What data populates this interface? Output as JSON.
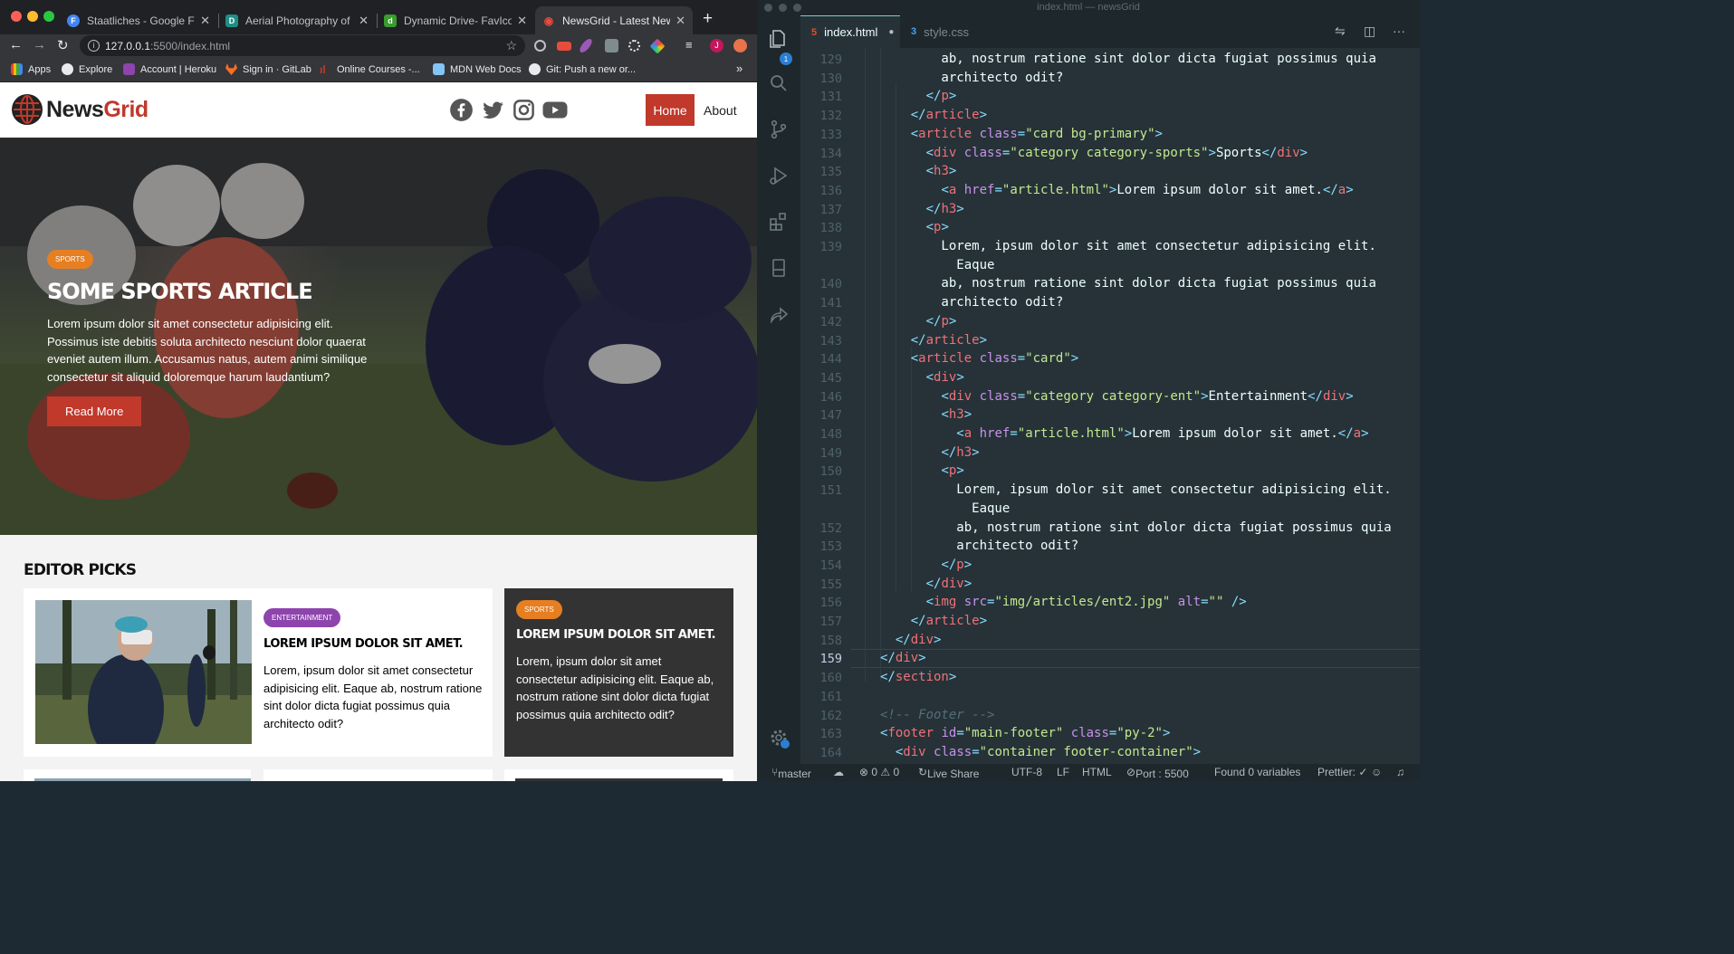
{
  "browser": {
    "tabs": [
      {
        "title": "Staatliches - Google Fonts",
        "favicon_color": "#4285f4",
        "favicon_letter": "F"
      },
      {
        "title": "Aerial Photography of Sea",
        "favicon_color": "#1d8f85",
        "favicon_letter": "D"
      },
      {
        "title": "Dynamic Drive- FavIcon Ge",
        "favicon_color": "#3a9b2e",
        "favicon_letter": "d"
      },
      {
        "title": "NewsGrid - Latest News",
        "favicon_color": "#c0392b",
        "favicon_letter": "◉"
      }
    ],
    "url_host": "127.0.0.1",
    "url_rest": ":5500/index.html",
    "bookmarks": [
      {
        "label": "Apps",
        "color": "#ea4335"
      },
      {
        "label": "Explore",
        "color": "#e8eaed"
      },
      {
        "label": "Account | Heroku",
        "color": "#8e44ad"
      },
      {
        "label": "Sign in · GitLab",
        "color": "#fc6d26"
      },
      {
        "label": "Online Courses -...",
        "color": "#c0392b"
      },
      {
        "label": "MDN Web Docs",
        "color": "#83c5f5"
      },
      {
        "label": "Git: Push a new or...",
        "color": "#e8eaed"
      }
    ],
    "bookmarks_more": "»"
  },
  "site": {
    "logo_part1": "News",
    "logo_part2": "Grid",
    "nav": {
      "home": "Home",
      "about": "About"
    },
    "hero": {
      "category": "Sports",
      "title": "Some Sports Article",
      "text": "Lorem ipsum dolor sit amet consectetur adipisicing elit. Possimus iste debitis soluta architecto nesciunt dolor quaerat eveniet autem illum. Accusamus natus, autem animi similique consectetur sit aliquid doloremque harum laudantium?",
      "button": "Read More"
    },
    "editor_picks_title": "Editor Picks",
    "cards": [
      {
        "category": "Entertainment",
        "title": "Lorem ipsum dolor sit amet.",
        "text": "Lorem, ipsum dolor sit amet consectetur adipisicing elit. Eaque ab, nostrum ratione sint dolor dicta fugiat possimus quia architecto odit?"
      },
      {
        "category": "Sports",
        "title": "Lorem ipsum dolor sit amet.",
        "text": "Lorem, ipsum dolor sit amet consectetur adipisicing elit. Eaque ab, nostrum ratione sint dolor dicta fugiat possimus quia architecto odit?"
      }
    ]
  },
  "editor": {
    "window_title": "index.html — newsGrid",
    "tabs": [
      {
        "label": "index.html",
        "icon": "5",
        "modified": "●"
      },
      {
        "label": "style.css",
        "icon": "3"
      }
    ],
    "explorer_badge": "1",
    "lines": [
      {
        "n": "129",
        "h": "<span class=\"cl-indent\" style=\"margin-left:0\"></span>        ab, nostrum ratione sint dolor dicta fugiat possimus quia"
      },
      {
        "n": "130",
        "h": "        architecto odit?"
      },
      {
        "n": "131",
        "h": "      <span class=\"p\">&lt;/</span><span class=\"t\">p</span><span class=\"p\">&gt;</span>"
      },
      {
        "n": "132",
        "h": "    <span class=\"p\">&lt;/</span><span class=\"t\">article</span><span class=\"p\">&gt;</span>"
      },
      {
        "n": "133",
        "h": "    <span class=\"p\">&lt;</span><span class=\"t\">article</span> <span class=\"a\">class</span><span class=\"p\">=</span><span class=\"s\">\"card bg-primary\"</span><span class=\"p\">&gt;</span>"
      },
      {
        "n": "134",
        "h": "      <span class=\"p\">&lt;</span><span class=\"t\">div</span> <span class=\"a\">class</span><span class=\"p\">=</span><span class=\"s\">\"category category-sports\"</span><span class=\"p\">&gt;</span>Sports<span class=\"p\">&lt;/</span><span class=\"t\">div</span><span class=\"p\">&gt;</span>"
      },
      {
        "n": "135",
        "h": "      <span class=\"p\">&lt;</span><span class=\"t\">h3</span><span class=\"p\">&gt;</span>"
      },
      {
        "n": "136",
        "h": "        <span class=\"p\">&lt;</span><span class=\"t\">a</span> <span class=\"a\">href</span><span class=\"p\">=</span><span class=\"s\">\"article.html\"</span><span class=\"p\">&gt;</span>Lorem ipsum dolor sit amet.<span class=\"p\">&lt;/</span><span class=\"t\">a</span><span class=\"p\">&gt;</span>"
      },
      {
        "n": "137",
        "h": "      <span class=\"p\">&lt;/</span><span class=\"t\">h3</span><span class=\"p\">&gt;</span>"
      },
      {
        "n": "138",
        "h": "      <span class=\"p\">&lt;</span><span class=\"t\">p</span><span class=\"p\">&gt;</span>"
      },
      {
        "n": "139",
        "h": "        Lorem, ipsum dolor sit amet consectetur adipisicing elit.\n          Eaque"
      },
      {
        "n": "140",
        "h": "        ab, nostrum ratione sint dolor dicta fugiat possimus quia"
      },
      {
        "n": "141",
        "h": "        architecto odit?"
      },
      {
        "n": "142",
        "h": "      <span class=\"p\">&lt;/</span><span class=\"t\">p</span><span class=\"p\">&gt;</span>"
      },
      {
        "n": "143",
        "h": "    <span class=\"p\">&lt;/</span><span class=\"t\">article</span><span class=\"p\">&gt;</span>"
      },
      {
        "n": "144",
        "h": "    <span class=\"p\">&lt;</span><span class=\"t\">article</span> <span class=\"a\">class</span><span class=\"p\">=</span><span class=\"s\">\"card\"</span><span class=\"p\">&gt;</span>"
      },
      {
        "n": "145",
        "h": "      <span class=\"p\">&lt;</span><span class=\"t\">div</span><span class=\"p\">&gt;</span>"
      },
      {
        "n": "146",
        "h": "        <span class=\"p\">&lt;</span><span class=\"t\">div</span> <span class=\"a\">class</span><span class=\"p\">=</span><span class=\"s\">\"category category-ent\"</span><span class=\"p\">&gt;</span>Entertainment<span class=\"p\">&lt;/</span><span class=\"t\">div</span><span class=\"p\">&gt;</span>"
      },
      {
        "n": "147",
        "h": "        <span class=\"p\">&lt;</span><span class=\"t\">h3</span><span class=\"p\">&gt;</span>"
      },
      {
        "n": "148",
        "h": "          <span class=\"p\">&lt;</span><span class=\"t\">a</span> <span class=\"a\">href</span><span class=\"p\">=</span><span class=\"s\">\"article.html\"</span><span class=\"p\">&gt;</span>Lorem ipsum dolor sit amet.<span class=\"p\">&lt;/</span><span class=\"t\">a</span><span class=\"p\">&gt;</span>"
      },
      {
        "n": "149",
        "h": "        <span class=\"p\">&lt;/</span><span class=\"t\">h3</span><span class=\"p\">&gt;</span>"
      },
      {
        "n": "150",
        "h": "        <span class=\"p\">&lt;</span><span class=\"t\">p</span><span class=\"p\">&gt;</span>"
      },
      {
        "n": "151",
        "h": "          Lorem, ipsum dolor sit amet consectetur adipisicing elit.\n            Eaque"
      },
      {
        "n": "152",
        "h": "          ab, nostrum ratione sint dolor dicta fugiat possimus quia"
      },
      {
        "n": "153",
        "h": "          architecto odit?"
      },
      {
        "n": "154",
        "h": "        <span class=\"p\">&lt;/</span><span class=\"t\">p</span><span class=\"p\">&gt;</span>"
      },
      {
        "n": "155",
        "h": "      <span class=\"p\">&lt;/</span><span class=\"t\">div</span><span class=\"p\">&gt;</span>"
      },
      {
        "n": "156",
        "h": "      <span class=\"p\">&lt;</span><span class=\"t\">img</span> <span class=\"a\">src</span><span class=\"p\">=</span><span class=\"s\">\"img/articles/ent2.jpg\"</span> <span class=\"a\">alt</span><span class=\"p\">=</span><span class=\"s\">\"\"</span> <span class=\"p\">/&gt;</span>"
      },
      {
        "n": "157",
        "h": "    <span class=\"p\">&lt;/</span><span class=\"t\">article</span><span class=\"p\">&gt;</span>"
      },
      {
        "n": "158",
        "h": "  <span class=\"p\">&lt;/</span><span class=\"t\">div</span><span class=\"p\">&gt;</span>"
      },
      {
        "n": "159",
        "h": "<span class=\"p\">&lt;/</span><span class=\"t\">div</span><span class=\"p\">&gt;</span>"
      },
      {
        "n": "160",
        "h": "<span class=\"p\">&lt;/</span><span class=\"t\">section</span><span class=\"p\">&gt;</span>"
      },
      {
        "n": "161",
        "h": ""
      },
      {
        "n": "162",
        "h": "<span class=\"c\">&lt;!-- Footer --&gt;</span>"
      },
      {
        "n": "163",
        "h": "<span class=\"p\">&lt;</span><span class=\"t\">footer</span> <span class=\"a\">id</span><span class=\"p\">=</span><span class=\"s\">\"main-footer\"</span> <span class=\"a\">class</span><span class=\"p\">=</span><span class=\"s\">\"py-2\"</span><span class=\"p\">&gt;</span>"
      },
      {
        "n": "164",
        "h": "  <span class=\"p\">&lt;</span><span class=\"t\">div</span> <span class=\"a\">class</span><span class=\"p\">=</span><span class=\"s\">\"container footer-container\"</span><span class=\"p\">&gt;</span>"
      }
    ],
    "current_line": "159",
    "status": {
      "branch": "master",
      "problems": "⊗ 0 ⚠ 0",
      "live_share": "Live Share",
      "encoding": "UTF-8",
      "eol": "LF",
      "language": "HTML",
      "port": "Port : 5500",
      "variables": "Found 0 variables",
      "prettier": "Prettier: ✓"
    }
  }
}
